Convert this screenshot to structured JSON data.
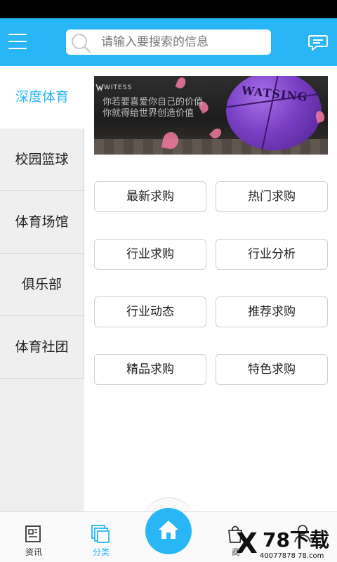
{
  "header": {
    "search_placeholder": "请输入要搜索的信息",
    "accent_color": "#29b6f6"
  },
  "sidebar": {
    "items": [
      {
        "label": "深度体育",
        "active": true
      },
      {
        "label": "校园篮球",
        "active": false
      },
      {
        "label": "体育场馆",
        "active": false
      },
      {
        "label": "俱乐部",
        "active": false
      },
      {
        "label": "体育社团",
        "active": false
      }
    ]
  },
  "banner": {
    "brand": "WITESS",
    "line1": "你若要喜爱你自己的价值",
    "line2": "你就得给世界创造价值",
    "ball_brand": "WATSING"
  },
  "categories": [
    {
      "label": "最新求购"
    },
    {
      "label": "热门求购"
    },
    {
      "label": "行业求购"
    },
    {
      "label": "行业分析"
    },
    {
      "label": "行业动态"
    },
    {
      "label": "推荐求购"
    },
    {
      "label": "精品求购"
    },
    {
      "label": "特色求购"
    }
  ],
  "bottom_nav": {
    "items": [
      {
        "label": "资讯",
        "icon": "news-icon",
        "active": false
      },
      {
        "label": "分类",
        "icon": "category-icon",
        "active": true
      },
      {
        "label": "商",
        "icon": "shopping-bag-icon",
        "active": false
      }
    ],
    "home_icon": "home-icon",
    "profile_icon": "user-icon"
  },
  "watermark": {
    "mark": "X",
    "text": "78下载",
    "url": "40077878 78.com"
  }
}
